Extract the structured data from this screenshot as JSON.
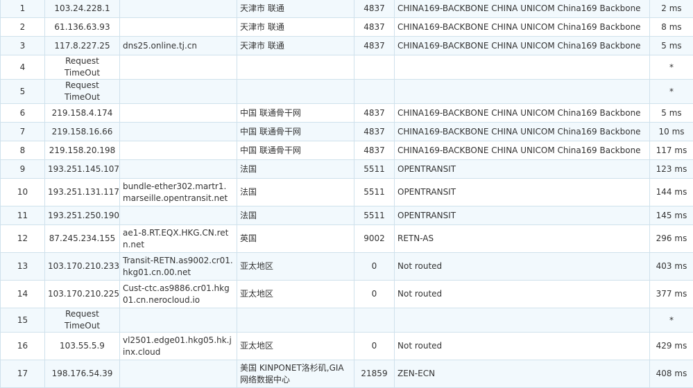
{
  "rows": [
    {
      "hop": "1",
      "ip": "103.24.228.1",
      "host": "",
      "location": "天津市 联通",
      "asn": "4837",
      "isp": "CHINA169-BACKBONE CHINA UNICOM China169 Backbone",
      "time": "2 ms"
    },
    {
      "hop": "2",
      "ip": "61.136.63.93",
      "host": "",
      "location": "天津市 联通",
      "asn": "4837",
      "isp": "CHINA169-BACKBONE CHINA UNICOM China169 Backbone",
      "time": "8 ms"
    },
    {
      "hop": "3",
      "ip": "117.8.227.25",
      "host": "dns25.online.tj.cn",
      "location": "天津市 联通",
      "asn": "4837",
      "isp": "CHINA169-BACKBONE CHINA UNICOM China169 Backbone",
      "time": "5 ms"
    },
    {
      "hop": "4",
      "ip": "Request TimeOut",
      "host": "",
      "location": "",
      "asn": "",
      "isp": "",
      "time": "*"
    },
    {
      "hop": "5",
      "ip": "Request TimeOut",
      "host": "",
      "location": "",
      "asn": "",
      "isp": "",
      "time": "*"
    },
    {
      "hop": "6",
      "ip": "219.158.4.174",
      "host": "",
      "location": "中国 联通骨干网",
      "asn": "4837",
      "isp": "CHINA169-BACKBONE CHINA UNICOM China169 Backbone",
      "time": "5 ms"
    },
    {
      "hop": "7",
      "ip": "219.158.16.66",
      "host": "",
      "location": "中国 联通骨干网",
      "asn": "4837",
      "isp": "CHINA169-BACKBONE CHINA UNICOM China169 Backbone",
      "time": "10 ms"
    },
    {
      "hop": "8",
      "ip": "219.158.20.198",
      "host": "",
      "location": "中国 联通骨干网",
      "asn": "4837",
      "isp": "CHINA169-BACKBONE CHINA UNICOM China169 Backbone",
      "time": "117 ms"
    },
    {
      "hop": "9",
      "ip": "193.251.145.107",
      "host": "",
      "location": "法国",
      "asn": "5511",
      "isp": "OPENTRANSIT",
      "time": "123 ms"
    },
    {
      "hop": "10",
      "ip": "193.251.131.117",
      "host": "bundle-ether302.martr1.marseille.opentransit.net",
      "location": "法国",
      "asn": "5511",
      "isp": "OPENTRANSIT",
      "time": "144 ms"
    },
    {
      "hop": "11",
      "ip": "193.251.250.190",
      "host": "",
      "location": "法国",
      "asn": "5511",
      "isp": "OPENTRANSIT",
      "time": "145 ms"
    },
    {
      "hop": "12",
      "ip": "87.245.234.155",
      "host": "ae1-8.RT.EQX.HKG.CN.retn.net",
      "location": "英国",
      "asn": "9002",
      "isp": "RETN-AS",
      "time": "296 ms"
    },
    {
      "hop": "13",
      "ip": "103.170.210.233",
      "host": "Transit-RETN.as9002.cr01.hkg01.cn.00.net",
      "location": "亚太地区",
      "asn": "0",
      "isp": "Not routed",
      "time": "403 ms"
    },
    {
      "hop": "14",
      "ip": "103.170.210.225",
      "host": "Cust-ctc.as9886.cr01.hkg01.cn.nerocloud.io",
      "location": "亚太地区",
      "asn": "0",
      "isp": "Not routed",
      "time": "377 ms"
    },
    {
      "hop": "15",
      "ip": "Request TimeOut",
      "host": "",
      "location": "",
      "asn": "",
      "isp": "",
      "time": "*"
    },
    {
      "hop": "16",
      "ip": "103.55.5.9",
      "host": "vl2501.edge01.hkg05.hk.jinx.cloud",
      "location": "亚太地区",
      "asn": "0",
      "isp": "Not routed",
      "time": "429 ms"
    },
    {
      "hop": "17",
      "ip": "198.176.54.39",
      "host": "",
      "location": "美国 KINPONET洛杉矶,GIA网络数据中心",
      "asn": "21859",
      "isp": "ZEN-ECN",
      "time": "408 ms"
    }
  ]
}
